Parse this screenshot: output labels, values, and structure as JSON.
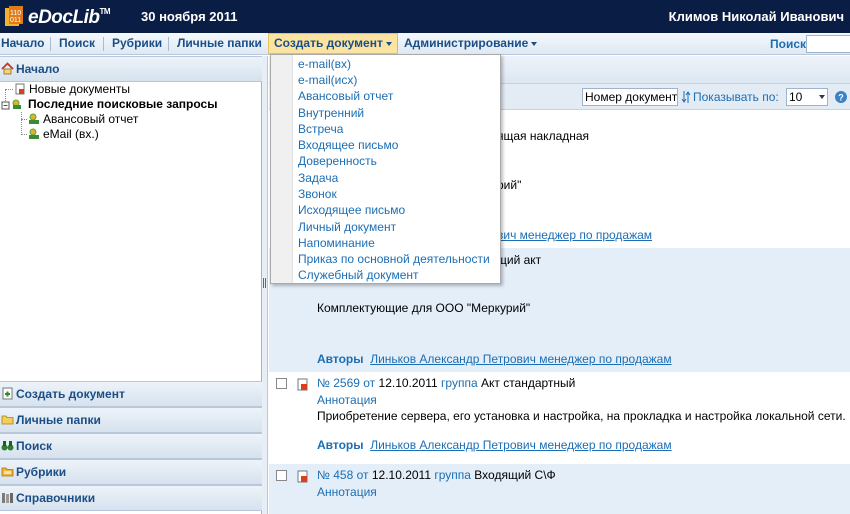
{
  "header": {
    "logo_text": "eDocLib",
    "logo_tm": "TM",
    "date": "30 ноября 2011",
    "user": "Климов Николай Иванович"
  },
  "menu": {
    "items": [
      "Начало",
      "Поиск",
      "Рубрики",
      "Личные папки",
      "Создать документ",
      "Администрирование"
    ],
    "search_label": "Поиск"
  },
  "left_panel": {
    "home_header": "Начало",
    "tree": {
      "new_docs": "Новые документы",
      "recent_searches": "Последние поисковые запросы",
      "search_1": "Авансовый отчет",
      "search_2": "eMail (вх.)"
    },
    "sections": [
      "Создать документ",
      "Личные папки",
      "Поиск",
      "Рубрики",
      "Справочники"
    ]
  },
  "toolbar": {
    "sort_value": "Номер документа",
    "show_label": "Показывать по:",
    "page_size": "10"
  },
  "dropdown": {
    "items": [
      "e-mail(вх)",
      "e-mail(исх)",
      "Авансовый отчет",
      "Внутренний",
      "Встреча",
      "Входящее письмо",
      "Доверенность",
      "Задача",
      "Звонок",
      "Исходящее письмо",
      "Личный документ",
      "Напоминание",
      "Приказ по основной деятельности",
      "Служебный документ"
    ]
  },
  "documents": {
    "partial_1_type": "ящая накладная",
    "partial_1_text": "рий\"",
    "partial_1_author": "вич менеджер по продажам",
    "partial_2_type": "щий акт",
    "doc2_annotation_text": "Комплектующие для ООО \"Меркурий\"",
    "authors_label": "Авторы",
    "doc2_author": "Линьков Александр Петрович менеджер по продажам",
    "no_label": "№",
    "from_label": "от",
    "group_label": "группа",
    "annotation_label": "Аннотация",
    "doc3": {
      "number": "2569",
      "date": "12.10.2011",
      "group": "Акт стандартный",
      "annotation": "Приобретение сервера, его установка и настройка, на прокладка и настройка локальной сети.",
      "author": "Линьков Александр Петрович менеджер по продажам"
    },
    "doc4": {
      "number": "458",
      "date": "12.10.2011",
      "group": "Входящий С\\Ф"
    }
  },
  "colors": {
    "header_bg": "#0a1d45",
    "link": "#1c6eb4",
    "menu_text": "#1c4e86",
    "active_menu": "#fbe3a2"
  }
}
